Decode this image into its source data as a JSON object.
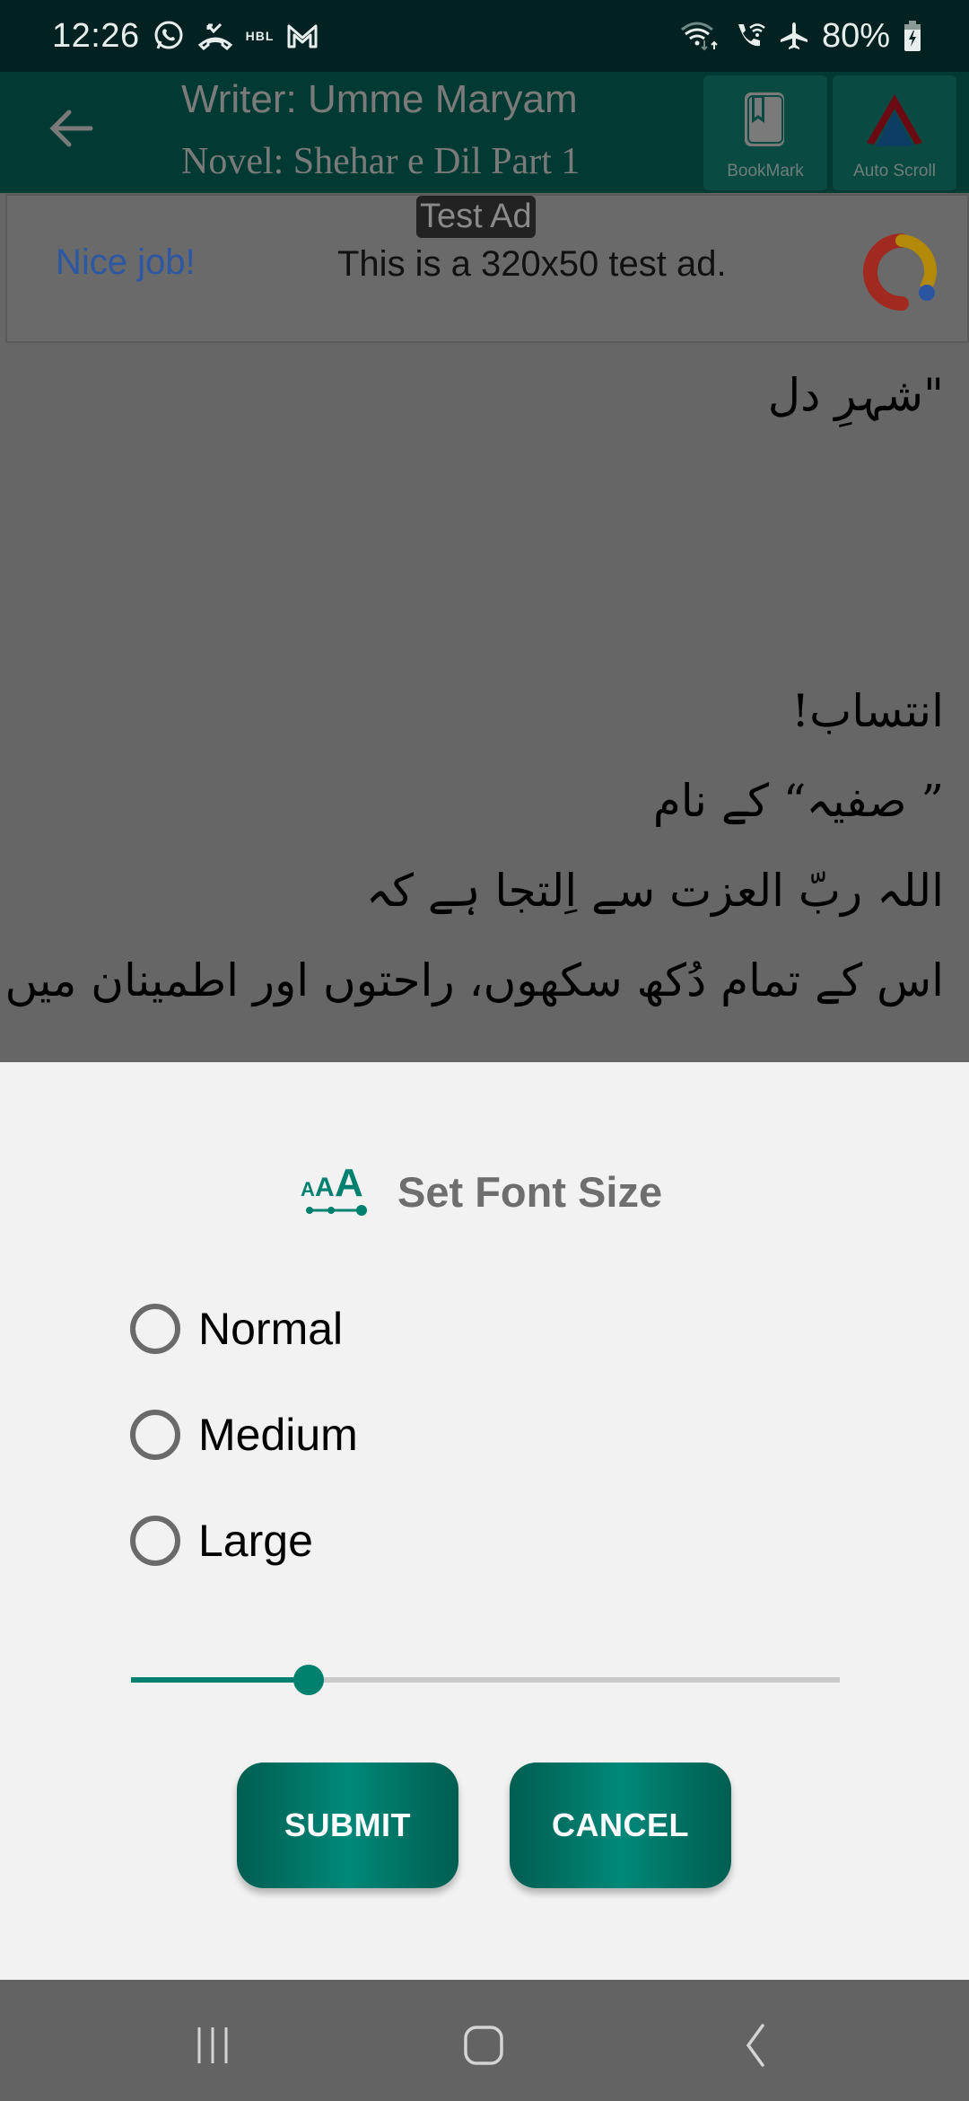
{
  "status_bar": {
    "time": "12:26",
    "notification_icons": [
      "whatsapp-icon",
      "missed-call-icon",
      "hbl-icon",
      "gmail-icon"
    ],
    "hbl_label": "HBL",
    "system_icons": [
      "wifi-icon",
      "wifi-calling-icon",
      "airplane-icon"
    ],
    "battery": "80%"
  },
  "app_bar": {
    "back_icon": "arrow-left-icon",
    "title": "Writer: Umme Maryam",
    "subtitle": "Novel: Shehar e Dil Part 1",
    "actions": [
      {
        "label": "BookMark",
        "icon": "bookmark-book-icon"
      },
      {
        "label": "Auto Scroll",
        "icon": "auto-scroll-icon"
      }
    ]
  },
  "ad": {
    "badge": "Test Ad",
    "headline": "Nice job!",
    "text": "This is a 320x50 test ad.",
    "logo": "admob-logo-icon"
  },
  "content": {
    "lines": [
      "\"شہرِ دل",
      "انتساب!",
      "” صفیہ“ کے نام",
      "اللہ ربّ العزت سے اِلتجا ہے کہ",
      "اس کے تمام دُکھ سکھوں، راحتوں اور اطمینان میں"
    ]
  },
  "dialog": {
    "icon": "font-size-icon",
    "title": "Set Font Size",
    "options": [
      {
        "label": "Normal",
        "selected": false
      },
      {
        "label": "Medium",
        "selected": false
      },
      {
        "label": "Large",
        "selected": false
      }
    ],
    "slider_value_fraction": 0.25,
    "submit_label": "SUBMIT",
    "cancel_label": "CANCEL"
  },
  "colors": {
    "accent": "#00806f",
    "app_bar": "#003a33",
    "status_bar": "#012220",
    "sheet_bg": "#f2f2f2"
  },
  "nav_bar": {
    "buttons": [
      "recents-icon",
      "home-icon",
      "back-icon"
    ]
  }
}
